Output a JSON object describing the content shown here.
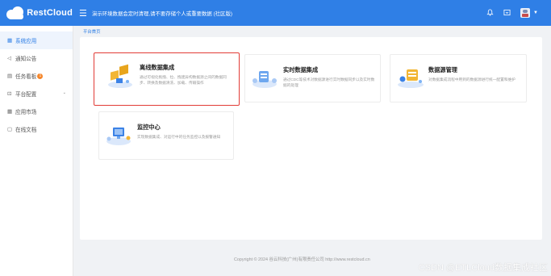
{
  "header": {
    "logo_text": "RestCloud",
    "notice": "演示环境数据会定时清理,请不要存储个人或重要数据 (社区版)",
    "icons": [
      "menu-toggle-icon",
      "bell-icon",
      "fullscreen-icon",
      "avatar",
      "caret-down-icon"
    ]
  },
  "sidebar": {
    "items": [
      {
        "label": "系统应用",
        "icon": "grid-icon",
        "active": true
      },
      {
        "label": "通知公告",
        "icon": "megaphone-icon"
      },
      {
        "label": "任务看板",
        "icon": "list-icon",
        "badge": "1"
      },
      {
        "label": "平台配置",
        "icon": "settings-icon",
        "has_children": true
      },
      {
        "label": "应用市场",
        "icon": "store-icon"
      },
      {
        "label": "在线文档",
        "icon": "document-icon"
      }
    ]
  },
  "breadcrumb": "平台首页",
  "cards": [
    {
      "title": "离线数据集成",
      "desc": "通过可视化拖拽、拉、拽建异构数据源之间的数据同步、转换及数据清洗、加载、传输操作",
      "highlighted": true
    },
    {
      "title": "实时数据集成",
      "desc": "通过CDC等技术对数据源进行实时数据同步以及实时数据的处理"
    },
    {
      "title": "数据源管理",
      "desc": "对数据集成流程中用到的数据源进行统一配置和维护"
    },
    {
      "title": "监控中心",
      "desc": "实现数据集成、对运行中的任务监控以及报警通知"
    }
  ],
  "footer": "Copyright © 2024  谷云科技(广州)有限责任公司  http://www.restcloud.cn",
  "watermark": "CSDN @ETLCloud数据集成社区",
  "colors": {
    "primary": "#2f7fe6",
    "highlight": "#e23c37",
    "badge": "#f5862a"
  }
}
